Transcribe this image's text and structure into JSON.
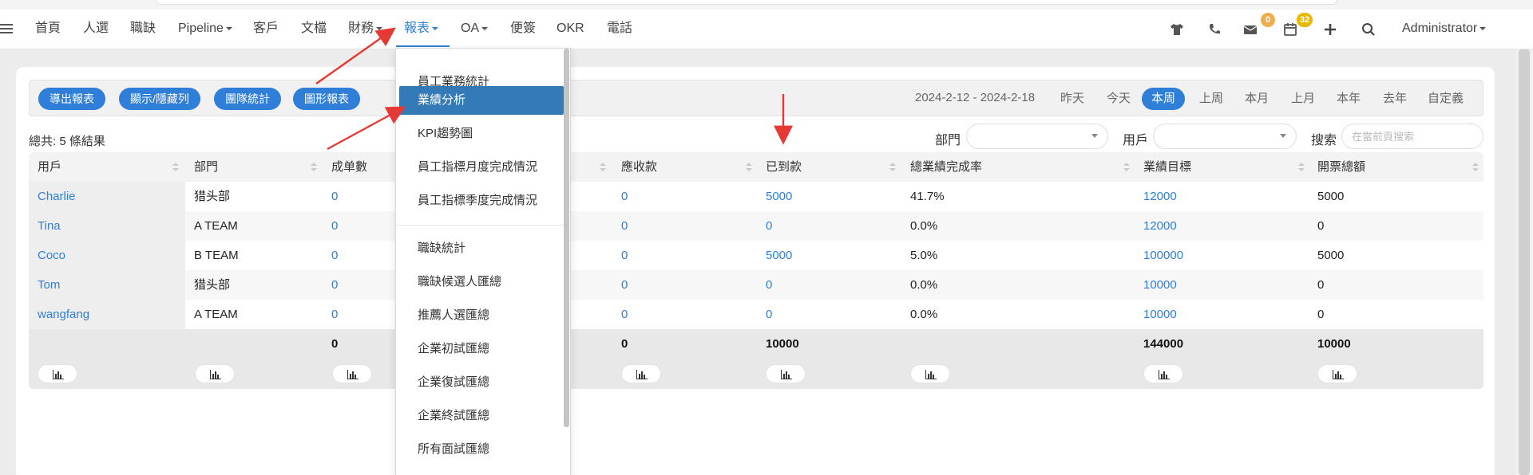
{
  "nav": {
    "items": [
      {
        "label": "首頁"
      },
      {
        "label": "人選"
      },
      {
        "label": "職缺"
      },
      {
        "label": "Pipeline",
        "dropdown": true
      },
      {
        "label": "客戶"
      },
      {
        "label": "文檔"
      },
      {
        "label": "財務",
        "dropdown": true
      },
      {
        "label": "報表",
        "dropdown": true,
        "active": true
      },
      {
        "label": "OA",
        "dropdown": true
      },
      {
        "label": "便簽"
      },
      {
        "label": "OKR"
      },
      {
        "label": "電話"
      }
    ],
    "mail_badge": "0",
    "calendar_badge": "32",
    "user": "Administrator"
  },
  "toolbar": {
    "buttons": [
      "導出報表",
      "顯示/隱藏列",
      "團隊統計",
      "圖形報表"
    ],
    "date_range": "2024-2-12 - 2024-2-18",
    "periods": [
      "昨天",
      "今天",
      "本周",
      "上周",
      "本月",
      "上月",
      "本年",
      "去年",
      "自定義"
    ],
    "active_period": "本周"
  },
  "filters": {
    "total": "總共: 5 條結果",
    "dept_label": "部門",
    "user_label": "用戶",
    "search_label": "搜索",
    "search_placeholder": "在當前頁搜索"
  },
  "table": {
    "headers": [
      "用戶",
      "部門",
      "成单數",
      "應收款",
      "已到款",
      "總業績完成率",
      "業績目標",
      "開票總額"
    ],
    "rows": [
      {
        "user": "Charlie",
        "dept": "猎头部",
        "deals": "0",
        "receivable": "0",
        "received": "5000",
        "rate": "41.7%",
        "target": "12000",
        "invoice": "5000"
      },
      {
        "user": "Tina",
        "dept": "A TEAM",
        "deals": "0",
        "receivable": "0",
        "received": "0",
        "rate": "0.0%",
        "target": "12000",
        "invoice": "0"
      },
      {
        "user": "Coco",
        "dept": "B TEAM",
        "deals": "0",
        "receivable": "0",
        "received": "5000",
        "rate": "5.0%",
        "target": "100000",
        "invoice": "5000"
      },
      {
        "user": "Tom",
        "dept": "猎头部",
        "deals": "0",
        "receivable": "0",
        "received": "0",
        "rate": "0.0%",
        "target": "10000",
        "invoice": "0"
      },
      {
        "user": "wangfang",
        "dept": "A TEAM",
        "deals": "0",
        "receivable": "0",
        "received": "0",
        "rate": "0.0%",
        "target": "10000",
        "invoice": "0"
      }
    ],
    "totals": {
      "deals": "0",
      "receivable": "0",
      "received": "10000",
      "target": "144000",
      "invoice": "10000"
    }
  },
  "menu": {
    "items": [
      "員工業務統計",
      "業績分析",
      "KPI趨勢圖",
      "員工指標月度完成情況",
      "員工指標季度完成情況",
      "職缺統計",
      "職缺候選人匯總",
      "推薦人選匯總",
      "企業初試匯總",
      "企業復試匯總",
      "企業終試匯總",
      "所有面試匯總"
    ],
    "active_index": 1
  },
  "colors": {
    "accent": "#2f7ed8",
    "menu_active": "#337ab7",
    "annotation_arrow": "#e53935"
  }
}
